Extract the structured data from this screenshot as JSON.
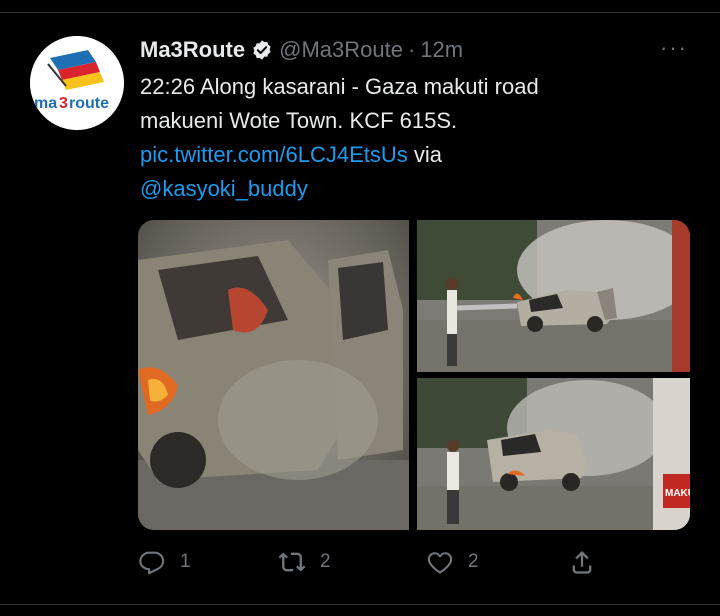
{
  "tweet": {
    "avatar": {
      "logo_text_a": "ma",
      "logo_text_b": "3",
      "logo_text_c": "route"
    },
    "display_name": "Ma3Route",
    "handle": "@Ma3Route",
    "separator": "·",
    "time": "12m",
    "more_label": "···",
    "text_line1": "22:26 Along kasarani - Gaza makuti road",
    "text_line2": "makueni Wote Town. KCF 615S.",
    "link": "pic.twitter.com/6LCJ4EtsUs",
    "via": " via",
    "mention": "@kasyoki_buddy",
    "photos": [
      {
        "plate_label": ""
      },
      {
        "plate_label": ""
      },
      {
        "truck_label": "MAKU"
      }
    ],
    "actions": {
      "reply_count": "1",
      "retweet_count": "2",
      "like_count": "2"
    }
  },
  "colors": {
    "background": "#000000",
    "text": "#e7e9ea",
    "muted": "#71767b",
    "link": "#1d9bf0",
    "verified": "#e7e9ea"
  }
}
